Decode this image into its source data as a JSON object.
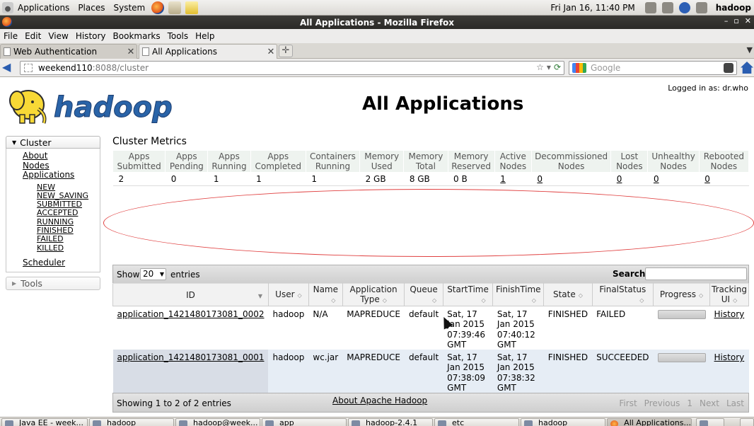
{
  "gnome_panel": {
    "menus": [
      "Applications",
      "Places",
      "System"
    ],
    "clock": "Fri Jan 16, 11:40 PM",
    "user": "hadoop"
  },
  "window": {
    "title": "All Applications - Mozilla Firefox",
    "buttons": [
      "–",
      "▫",
      "✕"
    ]
  },
  "firefox_menu": [
    "File",
    "Edit",
    "View",
    "History",
    "Bookmarks",
    "Tools",
    "Help"
  ],
  "tabs": [
    {
      "label": "Web Authentication"
    },
    {
      "label": "All Applications"
    }
  ],
  "navbar": {
    "url_host": "weekend110",
    "url_path": ":8088/cluster",
    "search_placeholder": "Google"
  },
  "page": {
    "logged_in": "Logged in as: dr.who",
    "logo_text": "hadoop",
    "title": "All Applications",
    "sidebar": {
      "cluster_label": "Cluster",
      "links": [
        "About",
        "Nodes",
        "Applications"
      ],
      "app_states": [
        "NEW",
        "NEW_SAVING",
        "SUBMITTED",
        "ACCEPTED",
        "RUNNING",
        "FINISHED",
        "FAILED",
        "KILLED"
      ],
      "scheduler": "Scheduler",
      "tools_label": "Tools"
    },
    "metrics": {
      "title": "Cluster Metrics",
      "headers": [
        "Apps Submitted",
        "Apps Pending",
        "Apps Running",
        "Apps Completed",
        "Containers Running",
        "Memory Used",
        "Memory Total",
        "Memory Reserved",
        "Active Nodes",
        "Decommissioned Nodes",
        "Lost Nodes",
        "Unhealthy Nodes",
        "Rebooted Nodes"
      ],
      "values": [
        "2",
        "0",
        "1",
        "1",
        "1",
        "2 GB",
        "8 GB",
        "0 B",
        "1",
        "0",
        "0",
        "0",
        "0"
      ]
    },
    "apps_table": {
      "show_label": "Show",
      "page_size": "20",
      "entries_label": "entries",
      "search_label": "Search:",
      "headers": [
        "ID",
        "User",
        "Name",
        "Application Type",
        "Queue",
        "StartTime",
        "FinishTime",
        "State",
        "FinalStatus",
        "Progress",
        "Tracking UI"
      ],
      "rows": [
        {
          "id": "application_1421480173081_0002",
          "user": "hadoop",
          "name": "N/A",
          "type": "MAPREDUCE",
          "queue": "default",
          "start": "Sat, 17 Jan 2015 07:39:46 GMT",
          "finish": "Sat, 17 Jan 2015 07:40:12 GMT",
          "state": "FINISHED",
          "final_status": "FAILED",
          "progress": 100,
          "tracking": "History"
        },
        {
          "id": "application_1421480173081_0001",
          "user": "hadoop",
          "name": "wc.jar",
          "type": "MAPREDUCE",
          "queue": "default",
          "start": "Sat, 17 Jan 2015 07:38:09 GMT",
          "finish": "Sat, 17 Jan 2015 07:38:32 GMT",
          "state": "FINISHED",
          "final_status": "SUCCEEDED",
          "progress": 100,
          "tracking": "History"
        }
      ],
      "info": "Showing 1 to 2 of 2 entries",
      "pager": [
        "First",
        "Previous",
        "1",
        "Next",
        "Last"
      ]
    },
    "footer_link": "About Apache Hadoop"
  },
  "taskbar": [
    "Java EE - week...",
    "hadoop",
    "hadoop@week...",
    "app",
    "hadoop-2.4.1",
    "etc",
    "hadoop",
    "All Applications..."
  ]
}
